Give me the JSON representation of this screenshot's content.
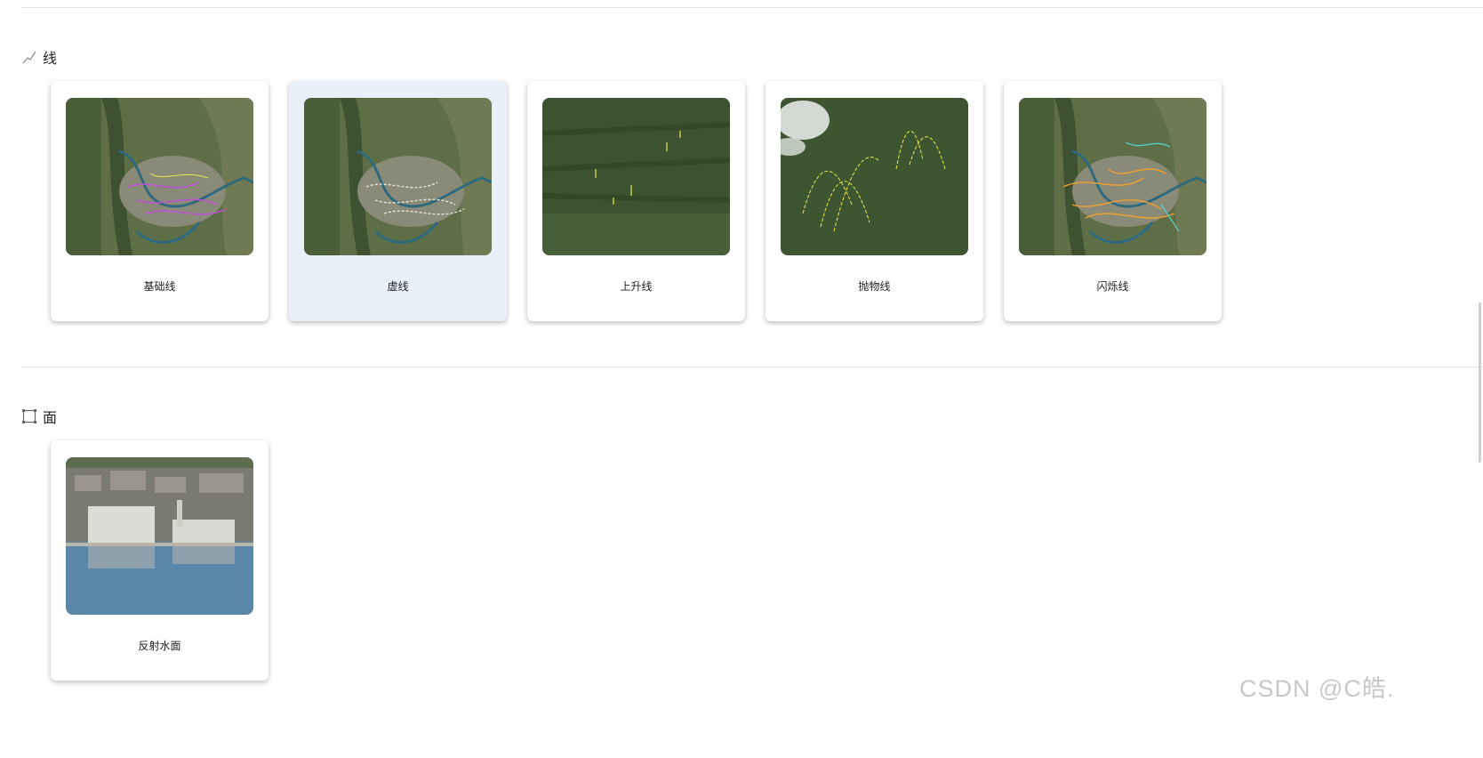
{
  "sections": [
    {
      "title": "线",
      "icon": "polyline-icon",
      "cards": [
        {
          "label": "基础线"
        },
        {
          "label": "虚线",
          "selected": true
        },
        {
          "label": "上升线"
        },
        {
          "label": "抛物线"
        },
        {
          "label": "闪烁线"
        }
      ]
    },
    {
      "title": "面",
      "icon": "polygon-icon",
      "cards": [
        {
          "label": "反射水面"
        }
      ]
    }
  ],
  "watermark": "CSDN @C皓.",
  "colors": {
    "selected_card_bg": "#e9f0fa",
    "divider": "#e3e3e3",
    "line_purple": "#c04fd8",
    "line_yellow": "#e8e84a",
    "line_orange": "#f0a030",
    "line_cyan": "#4fd6d0"
  }
}
